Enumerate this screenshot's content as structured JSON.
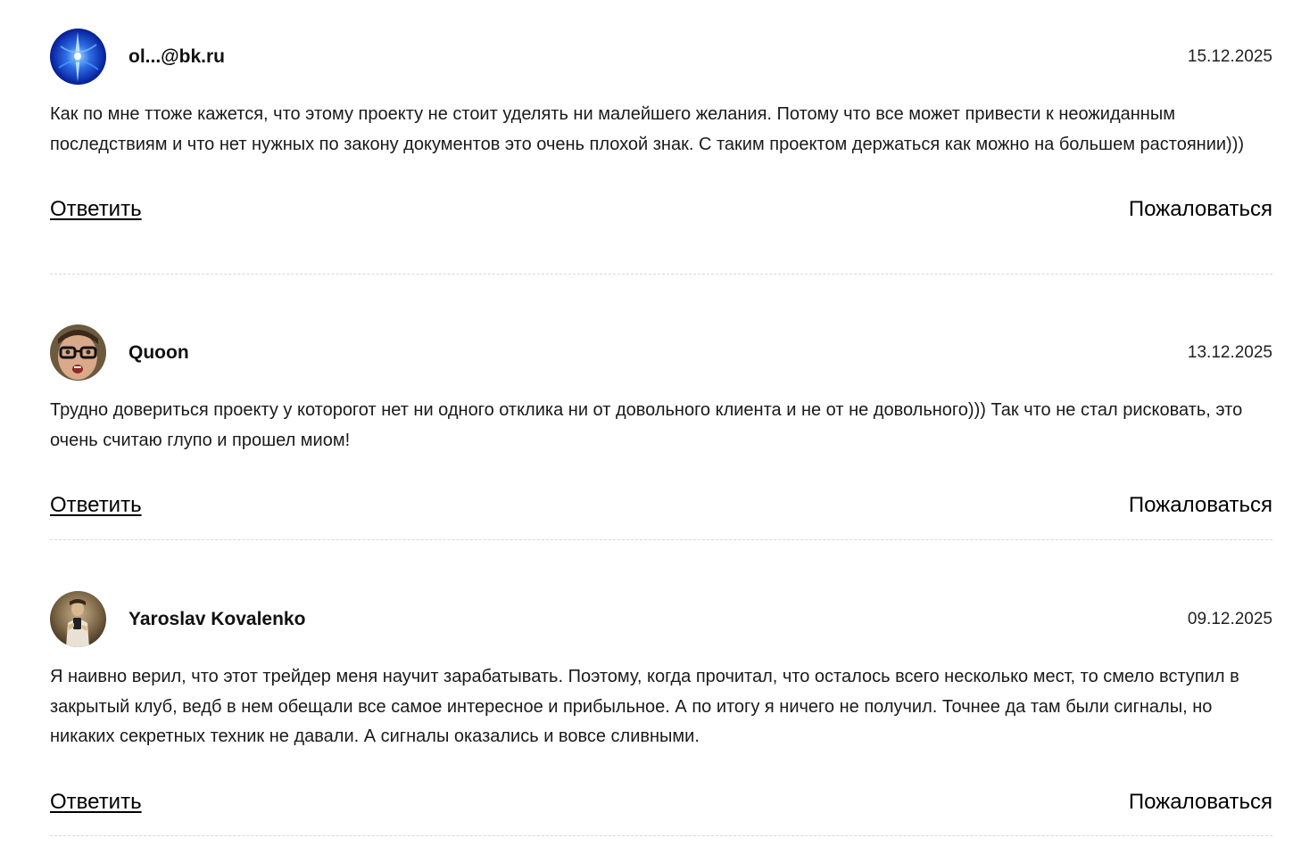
{
  "comments": [
    {
      "author": "ol...@bk.ru",
      "date": "15.12.2025",
      "text": "Как по мне ттоже кажется, что этому проекту не стоит уделять ни малейшего желания. Потому что все может привести к неожиданным последствиям и что нет нужных по закону документов это очень плохой знак. С таким проектом держаться как можно на большем растоянии)))",
      "reply_label": "Ответить",
      "report_label": "Пожаловаться",
      "avatar_icon": "blue-abstract-avatar-icon"
    },
    {
      "author": "Quoon",
      "date": "13.12.2025",
      "text": "Трудно довериться проекту у которогот нет ни одного отклика ни от довольного клиента и не от не довольного))) Так что не стал рисковать, это очень считаю глупо и прошел миом!",
      "reply_label": "Ответить",
      "report_label": "Пожаловаться",
      "avatar_icon": "man-with-glasses-avatar-icon"
    },
    {
      "author": "Yaroslav Kovalenko",
      "date": "09.12.2025",
      "text": "Я наивно верил, что этот трейдер меня научит зарабатывать. Поэтому, когда прочитал, что осталось всего несколько мест, то смело вступил в закрытый клуб, ведб в нем обещали все самое интересное и прибыльное. А по итогу я ничего не получил. Точнее да там были сигналы, но никаких секретных техник не давали. А сигналы оказались и вовсе сливными.",
      "reply_label": "Ответить",
      "report_label": "Пожаловаться",
      "avatar_icon": "person-photo-avatar-icon"
    }
  ],
  "colors": {
    "text": "#1a1a1a",
    "link": "#000000",
    "divider": "#d9d9d9"
  }
}
